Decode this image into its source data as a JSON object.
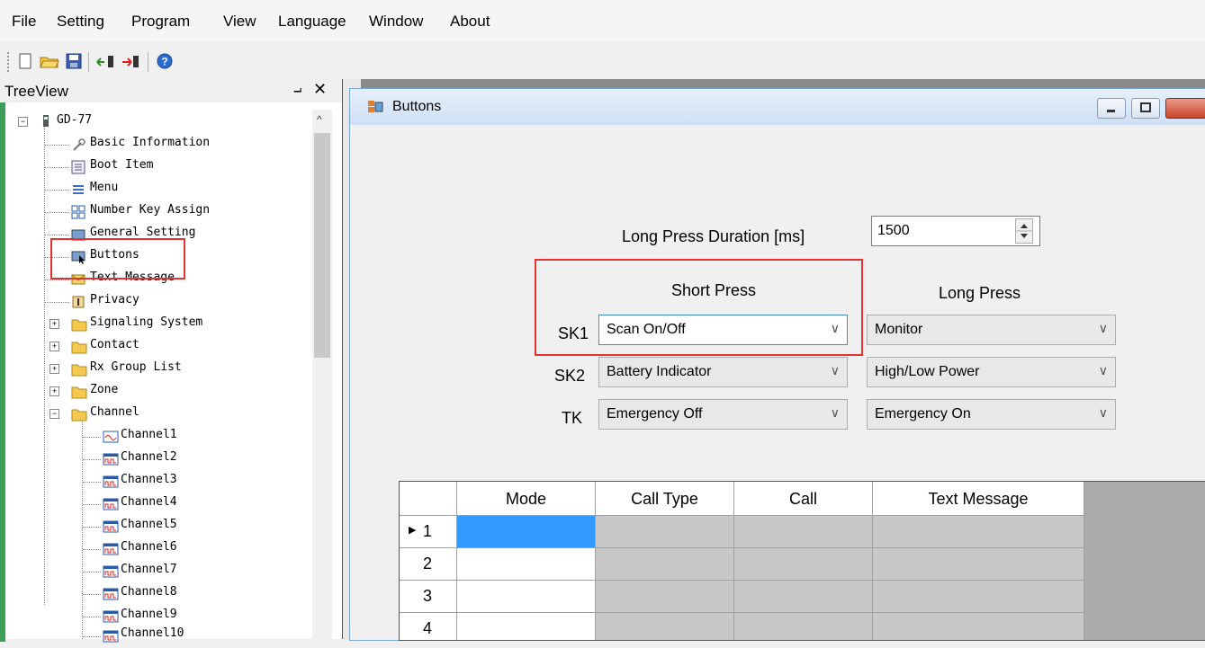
{
  "menu": [
    "File",
    "Setting",
    "Program",
    "View",
    "Language",
    "Window",
    "About"
  ],
  "toolbar": [
    "new-icon",
    "open-icon",
    "save-icon",
    "read-icon",
    "write-icon",
    "help-icon"
  ],
  "treeview": {
    "title": "TreeView",
    "pin": "⨼",
    "close": "✕",
    "items": [
      {
        "label": "GD-77"
      },
      {
        "label": "Basic Information"
      },
      {
        "label": "Boot Item"
      },
      {
        "label": "Menu"
      },
      {
        "label": "Number Key Assign"
      },
      {
        "label": "General Setting"
      },
      {
        "label": "Buttons"
      },
      {
        "label": "Text Message"
      },
      {
        "label": "Privacy"
      },
      {
        "label": "Signaling System"
      },
      {
        "label": "Contact"
      },
      {
        "label": "Rx Group List"
      },
      {
        "label": "Zone"
      },
      {
        "label": "Channel"
      },
      {
        "label": "Channel1"
      },
      {
        "label": "Channel2"
      },
      {
        "label": "Channel3"
      },
      {
        "label": "Channel4"
      },
      {
        "label": "Channel5"
      },
      {
        "label": "Channel6"
      },
      {
        "label": "Channel7"
      },
      {
        "label": "Channel8"
      },
      {
        "label": "Channel9"
      },
      {
        "label": "Channel10"
      }
    ]
  },
  "window": {
    "title": "Buttons",
    "long_press_label": "Long Press Duration [ms]",
    "long_press_value": "1500",
    "short_press_header": "Short Press",
    "long_press_header": "Long Press",
    "rows": [
      {
        "key": "SK1",
        "short": "Scan On/Off",
        "long": "Monitor"
      },
      {
        "key": "SK2",
        "short": "Battery Indicator",
        "long": "High/Low Power"
      },
      {
        "key": "TK",
        "short": "Emergency Off",
        "long": "Emergency On"
      }
    ],
    "grid": {
      "columns": [
        "Mode",
        "Call Type",
        "Call",
        "Text Message"
      ],
      "rows": [
        "1",
        "2",
        "3",
        "4"
      ],
      "current_row_marker": "▶"
    }
  }
}
